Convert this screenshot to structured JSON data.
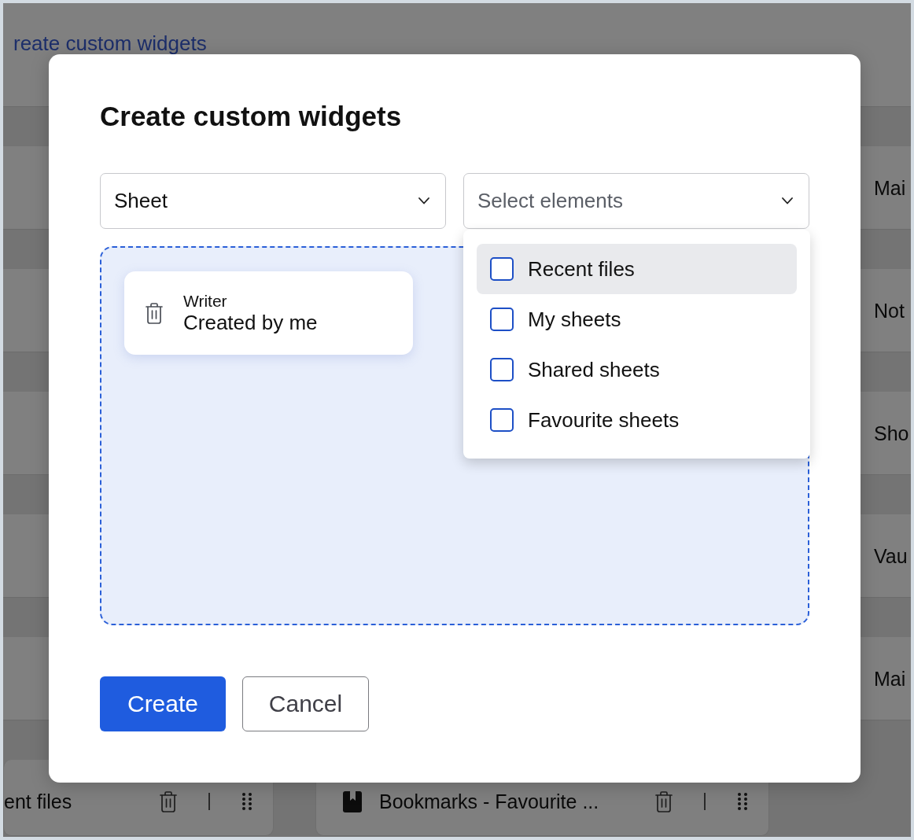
{
  "background": {
    "heading": "reate custom widgets",
    "list_rows": [
      {
        "label": "Mai"
      },
      {
        "label": "Not"
      },
      {
        "label": "Sho"
      },
      {
        "label": "Vau"
      },
      {
        "label": "Mai"
      }
    ],
    "widget_cards": [
      {
        "title": "ent files",
        "leading_icon": false
      },
      {
        "title": "Bookmarks - Favourite ...",
        "leading_icon": true
      }
    ]
  },
  "dialog": {
    "title": "Create custom widgets",
    "type_select": {
      "value": "Sheet"
    },
    "elements_select": {
      "placeholder": "Select elements",
      "expanded": true,
      "options": [
        {
          "label": "Recent files",
          "checked": false,
          "highlighted": true
        },
        {
          "label": "My sheets",
          "checked": false,
          "highlighted": false
        },
        {
          "label": "Shared sheets",
          "checked": false,
          "highlighted": false
        },
        {
          "label": "Favourite sheets",
          "checked": false,
          "highlighted": false
        }
      ]
    },
    "drop_zone": {
      "widgets": [
        {
          "app": "Writer",
          "name": "Created by me"
        }
      ]
    },
    "buttons": [
      {
        "label": "Create",
        "kind": "primary"
      },
      {
        "label": "Cancel",
        "kind": "secondary"
      }
    ]
  }
}
